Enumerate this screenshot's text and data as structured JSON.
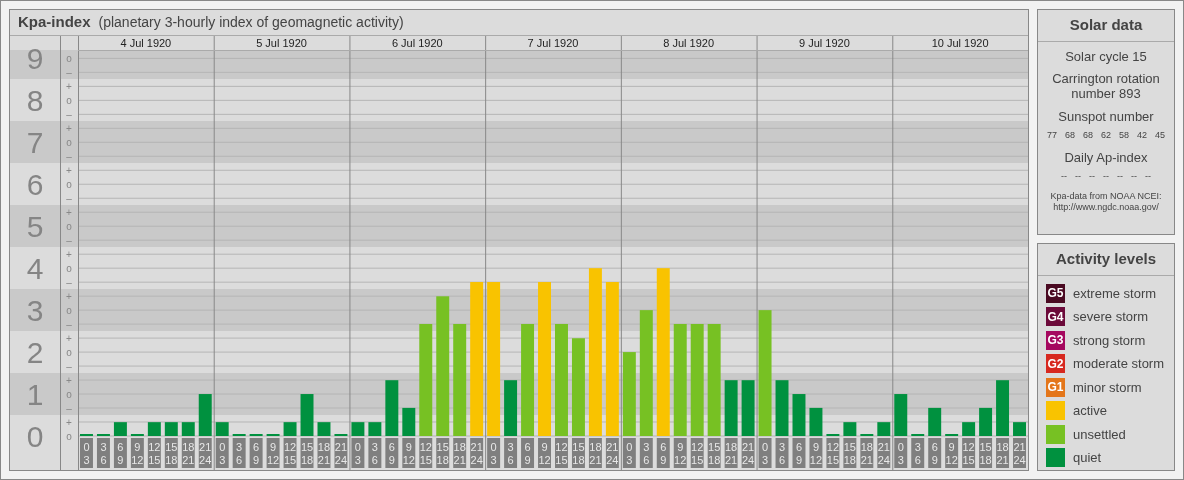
{
  "main_panel": {
    "title": "Kpa-index",
    "subtitle": "(planetary 3-hourly index of geomagnetic activity)",
    "chart_data": {
      "type": "bar",
      "grid": true,
      "ylim": [
        0,
        9.2
      ],
      "yticks": [
        {
          "value": 0,
          "label": "0"
        },
        {
          "value": 1,
          "label": "1"
        },
        {
          "value": 2,
          "label": "2"
        },
        {
          "value": 3,
          "label": "3"
        },
        {
          "value": 4,
          "label": "4"
        },
        {
          "value": 5,
          "label": "5"
        },
        {
          "value": 6,
          "label": "6"
        },
        {
          "value": 7,
          "label": "7"
        },
        {
          "value": 8,
          "label": "8"
        },
        {
          "value": 9,
          "label": "9"
        }
      ],
      "categories": [
        "0 3",
        "3 6",
        "6 9",
        "9 12",
        "12 15",
        "15 18",
        "18 21",
        "21 24",
        "0 3",
        "3 6",
        "6 9",
        "9 12",
        "12 15",
        "15 18",
        "18 21",
        "21 24",
        "0 3",
        "3 6",
        "6 9",
        "9 12",
        "12 15",
        "15 18",
        "18 21",
        "21 24",
        "0 3",
        "3 6",
        "6 9",
        "9 12",
        "12 15",
        "15 18",
        "18 21",
        "21 24",
        "0 3",
        "3 6",
        "6 9",
        "9 12",
        "12 15",
        "15 18",
        "18 21",
        "21 24",
        "0 3",
        "3 6",
        "6 9",
        "9 12",
        "12 15",
        "15 18",
        "18 21",
        "21 24",
        "0 3",
        "3 6",
        "6 9",
        "9 12",
        "12 15",
        "15 18",
        "18 21",
        "21 24"
      ],
      "series": [
        {
          "name": "quiet",
          "color": "#00913f",
          "values": [
            0,
            0,
            0.33,
            0,
            0.33,
            0.33,
            0.33,
            1,
            0.33,
            0,
            0,
            0,
            0.33,
            1,
            0.33,
            0,
            0.33,
            0.33,
            1.33,
            0.67,
            null,
            null,
            null,
            null,
            null,
            1.33,
            null,
            null,
            null,
            null,
            null,
            null,
            null,
            null,
            null,
            null,
            null,
            null,
            1.33,
            1.33,
            null,
            1.33,
            1,
            0.67,
            0,
            0.33,
            0,
            0.33,
            1,
            0,
            0.67,
            0,
            0.33,
            0.67,
            1.33,
            0.33
          ]
        },
        {
          "name": "unsettled",
          "color": "#77c123",
          "values": [
            null,
            null,
            null,
            null,
            null,
            null,
            null,
            null,
            null,
            null,
            null,
            null,
            null,
            null,
            null,
            null,
            null,
            null,
            null,
            null,
            2.67,
            3.33,
            2.67,
            null,
            null,
            null,
            2.67,
            null,
            2.67,
            2.33,
            null,
            null,
            2,
            3,
            null,
            2.67,
            2.67,
            2.67,
            null,
            null,
            3,
            null,
            null,
            null,
            null,
            null,
            null,
            null,
            null,
            null,
            null,
            null,
            null,
            null,
            null,
            null
          ]
        },
        {
          "name": "active",
          "color": "#f9c300",
          "values": [
            null,
            null,
            null,
            null,
            null,
            null,
            null,
            null,
            null,
            null,
            null,
            null,
            null,
            null,
            null,
            null,
            null,
            null,
            null,
            null,
            null,
            null,
            null,
            3.67,
            3.67,
            null,
            null,
            3.67,
            null,
            null,
            4,
            3.67,
            null,
            null,
            4,
            null,
            null,
            null,
            null,
            null,
            null,
            null,
            null,
            null,
            null,
            null,
            null,
            null,
            null,
            null,
            null,
            null,
            null,
            null,
            null,
            null
          ]
        }
      ]
    },
    "y_sublabels": [
      "o",
      "–",
      "+",
      "o",
      "–",
      "+",
      "o",
      "–",
      "+",
      "o",
      "–",
      "+",
      "o",
      "–",
      "+",
      "o",
      "–",
      "+",
      "o",
      "–",
      "+",
      "o",
      "–",
      "+",
      "o",
      "–",
      "+",
      "o"
    ],
    "day_labels": [
      "4 Jul 1920",
      "5 Jul 1920",
      "6 Jul 1920",
      "7 Jul 1920",
      "8 Jul 1920",
      "9 Jul 1920",
      "10 Jul 1920"
    ]
  },
  "solar_data": {
    "title": "Solar data",
    "solar_cycle": "Solar cycle 15",
    "carrington": "Carrington rotation number 893",
    "sunspot_label": "Sunspot number",
    "sunspot_numbers": [
      "77",
      "68",
      "68",
      "62",
      "58",
      "42",
      "45"
    ],
    "ap_label": "Daily Ap-index",
    "ap_values": [
      "--",
      "--",
      "--",
      "--",
      "--",
      "--",
      "--"
    ],
    "source": [
      "Kpa-data from NOAA NCEI:",
      "http://www.ngdc.noaa.gov/"
    ]
  },
  "activity_levels": {
    "title": "Activity levels",
    "items": [
      {
        "badge": "G5",
        "label": "extreme storm",
        "color": "#4a0a22"
      },
      {
        "badge": "G4",
        "label": "severe storm",
        "color": "#6c0a3a"
      },
      {
        "badge": "G3",
        "label": "strong storm",
        "color": "#a5085f"
      },
      {
        "badge": "G2",
        "label": "moderate storm",
        "color": "#d7281f"
      },
      {
        "badge": "G1",
        "label": "minor storm",
        "color": "#e4761a"
      }
    ]
  }
}
